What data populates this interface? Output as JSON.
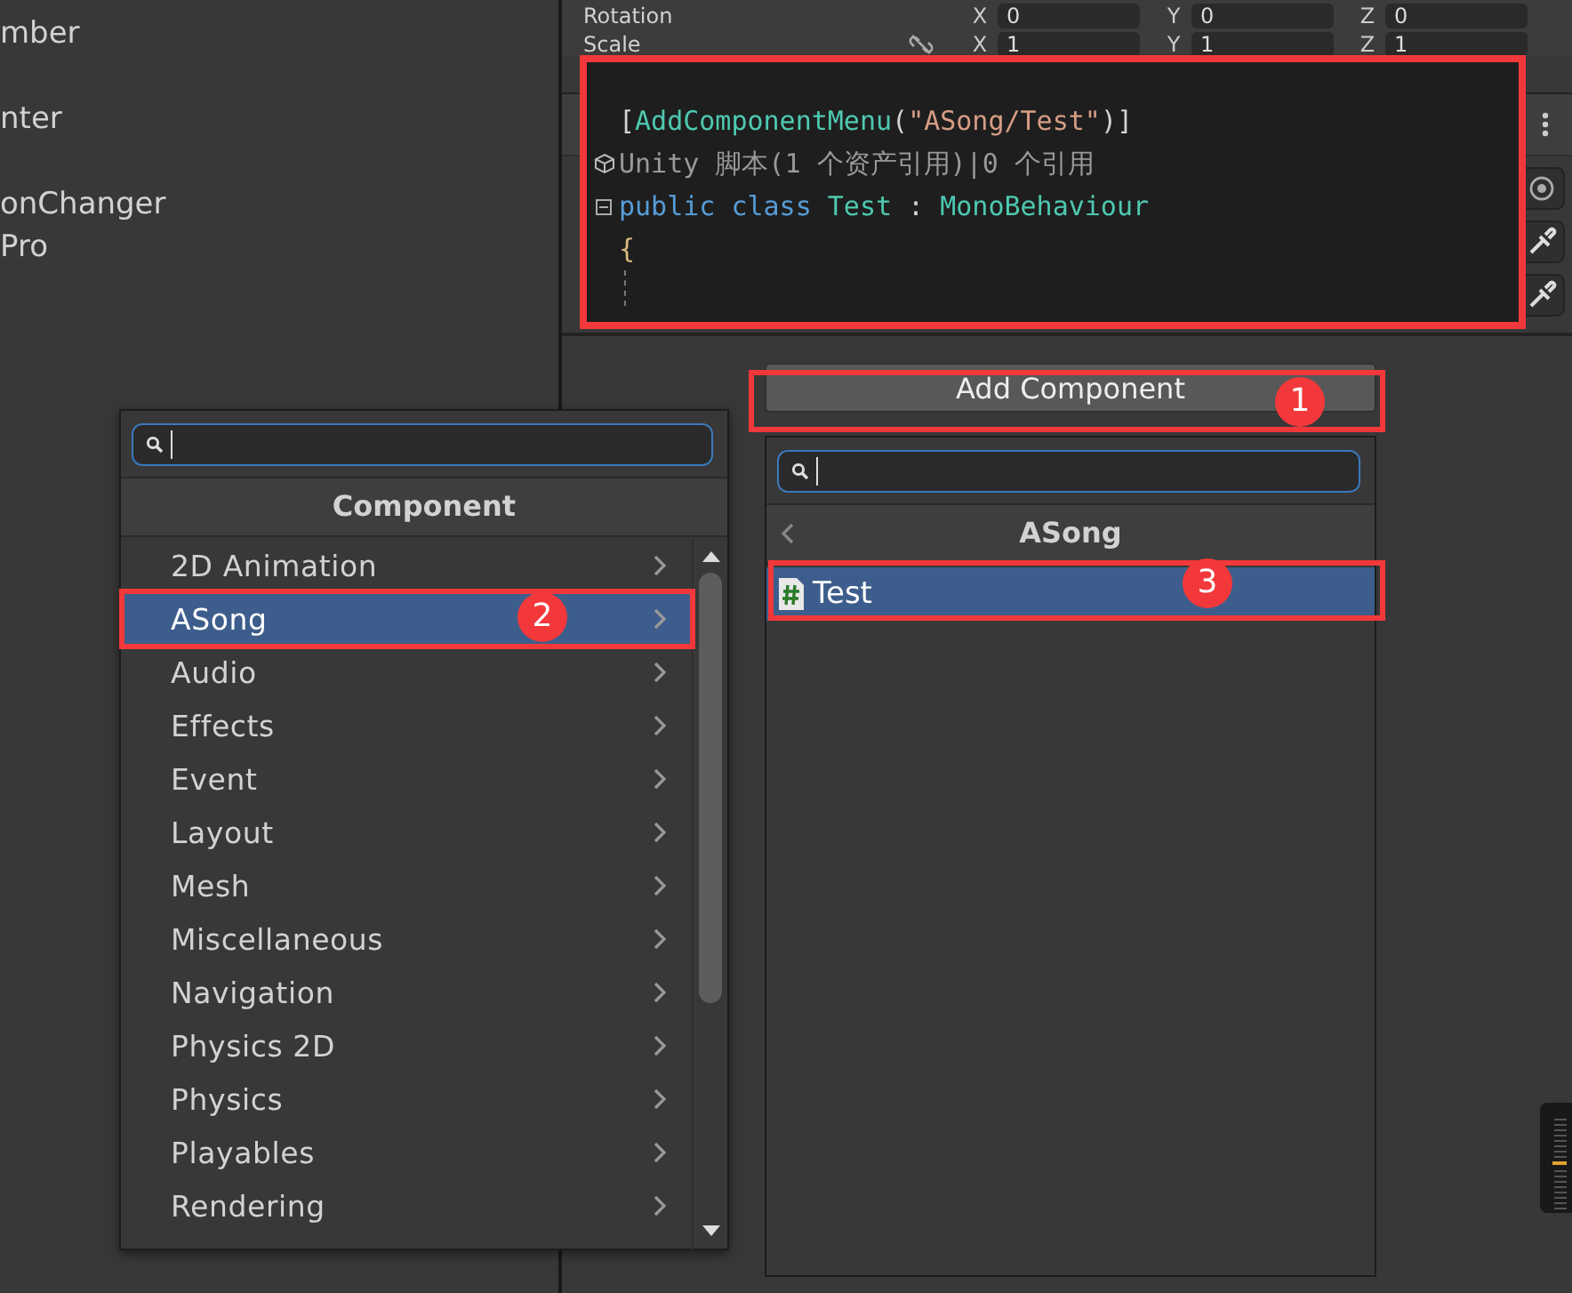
{
  "hierarchy": {
    "items": [
      "mber",
      "nter",
      "onChanger",
      "Pro"
    ]
  },
  "transform": {
    "rows": [
      {
        "label": "Rotation",
        "fields": [
          {
            "axis": "X",
            "value": "0"
          },
          {
            "axis": "Y",
            "value": "0"
          },
          {
            "axis": "Z",
            "value": "0"
          }
        ]
      },
      {
        "label": "Scale",
        "fields": [
          {
            "axis": "X",
            "value": "1"
          },
          {
            "axis": "Y",
            "value": "1"
          },
          {
            "axis": "Z",
            "value": "1"
          }
        ]
      }
    ]
  },
  "code_snippet": {
    "lines": [
      {
        "kind": "attribute",
        "segments": [
          {
            "kind": "punct",
            "text": "["
          },
          {
            "kind": "type",
            "text": "AddComponentMenu"
          },
          {
            "kind": "punct",
            "text": "("
          },
          {
            "kind": "string",
            "text": "\"ASong/Test\""
          },
          {
            "kind": "punct",
            "text": ")]"
          }
        ]
      },
      {
        "kind": "codelens",
        "segments": [
          {
            "kind": "lens",
            "text": "Unity 脚本(1 个资产引用)|0 个引用"
          }
        ]
      },
      {
        "kind": "declaration",
        "segments": [
          {
            "kind": "keyword",
            "text": "public class "
          },
          {
            "kind": "type",
            "text": "Test"
          },
          {
            "kind": "punct",
            "text": " : "
          },
          {
            "kind": "type",
            "text": "MonoBehaviour"
          }
        ]
      },
      {
        "kind": "code",
        "segments": [
          {
            "kind": "brace",
            "text": "{"
          }
        ]
      }
    ]
  },
  "add_component_button": {
    "label": "Add Component"
  },
  "component_menu": {
    "title": "Component",
    "items": [
      {
        "label": "2D Animation",
        "selected": false
      },
      {
        "label": "ASong",
        "selected": true
      },
      {
        "label": "Audio",
        "selected": false
      },
      {
        "label": "Effects",
        "selected": false
      },
      {
        "label": "Event",
        "selected": false
      },
      {
        "label": "Layout",
        "selected": false
      },
      {
        "label": "Mesh",
        "selected": false
      },
      {
        "label": "Miscellaneous",
        "selected": false
      },
      {
        "label": "Navigation",
        "selected": false
      },
      {
        "label": "Physics 2D",
        "selected": false
      },
      {
        "label": "Physics",
        "selected": false
      },
      {
        "label": "Playables",
        "selected": false
      },
      {
        "label": "Rendering",
        "selected": false
      }
    ]
  },
  "submenu": {
    "title": "ASong",
    "items": [
      {
        "label": "Test",
        "selected": true
      }
    ]
  },
  "annotations": [
    {
      "number": "1"
    },
    {
      "number": "2"
    },
    {
      "number": "3"
    }
  ]
}
